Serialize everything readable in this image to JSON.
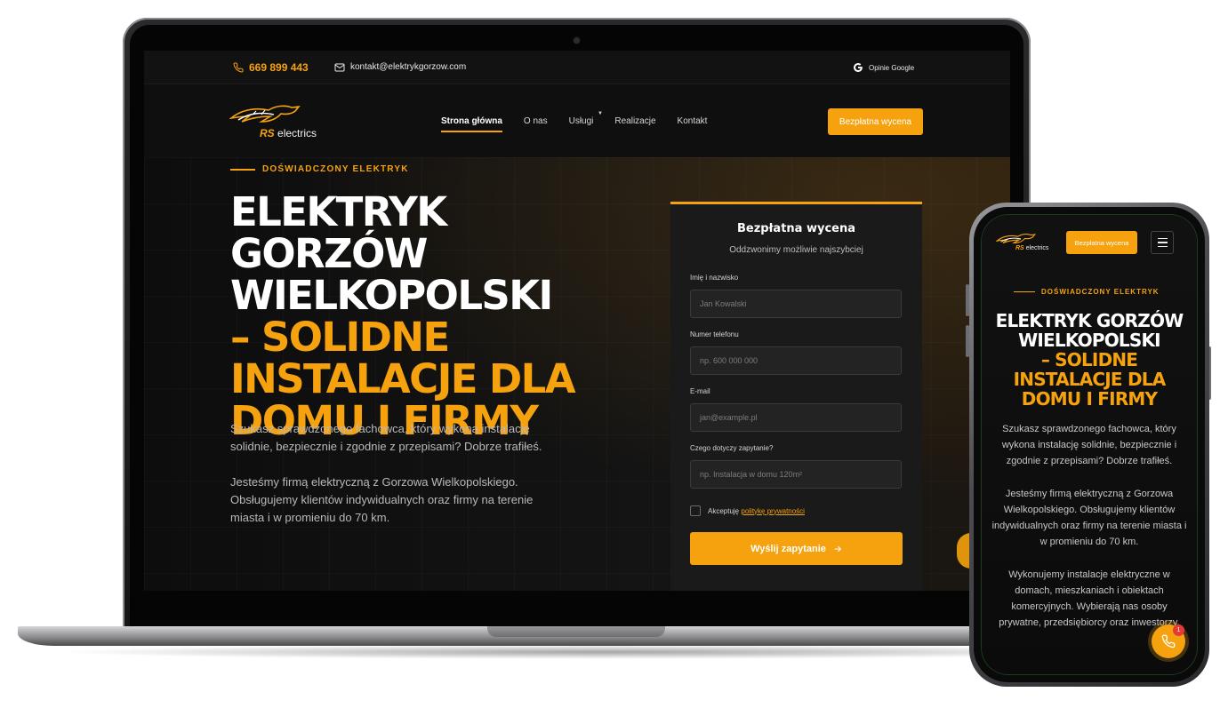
{
  "laptop": {
    "topbar": {
      "phone": "669 899 443",
      "email": "kontakt@elektrykgorzow.com",
      "google": "Opinie Google"
    },
    "logo": {
      "rs": "RS",
      "name": "electrics"
    },
    "nav": {
      "items": [
        "Strona główna",
        "O nas",
        "Usługi",
        "Realizacje",
        "Kontakt"
      ],
      "active": "Strona główna",
      "cta": "Bezpłatna wycena"
    },
    "hero": {
      "eyebrow": "DOŚWIADCZONY ELEKTRYK",
      "title_line1": "ELEKTRYK GORZÓW",
      "title_line2": "WIELKOPOLSKI",
      "title_accent1": "– SOLIDNE",
      "title_accent2": "INSTALACJE DLA",
      "title_accent3": "DOMU I FIRMY",
      "p1": "Szukasz sprawdzonego fachowca, który wykona instalację solidnie, bezpiecznie i zgodnie z przepisami? Dobrze trafiłeś.",
      "p2": "Jesteśmy firmą elektryczną z Gorzowa Wielkopolskiego. Obsługujemy klientów indywidualnych oraz firmy na terenie miasta i w promieniu do 70 km."
    },
    "form": {
      "title": "Bezpłatna wycena",
      "subtitle": "Oddzwonimy możliwie najszybciej",
      "name_label": "Imię i nazwisko",
      "name_placeholder": "Jan Kowalski",
      "phone_label": "Numer telefonu",
      "phone_placeholder": "np. 600 000 000",
      "email_label": "E-mail",
      "email_placeholder": "jan@example.pl",
      "topic_label": "Czego dotyczy zapytanie?",
      "topic_placeholder": "np. Instalacja w domu 120m²",
      "consent_prefix": "Akceptuję",
      "consent_link": "politykę prywatności",
      "submit": "Wyślij zapytanie"
    }
  },
  "phone": {
    "logo": {
      "rs": "RS",
      "name": "electrics"
    },
    "cta": "Bezpłatna wycena",
    "eyebrow": "DOŚWIADCZONY ELEKTRYK",
    "title_line1": "ELEKTRYK GORZÓW",
    "title_line2": "WIELKOPOLSKI",
    "title_accent1": "– SOLIDNE",
    "title_accent2": "INSTALACJE DLA",
    "title_accent3": "DOMU I FIRMY",
    "p1": "Szukasz sprawdzonego fachowca, który wykona instalację solidnie, bezpiecznie i zgodnie z przepisami? Dobrze trafiłeś.",
    "p2": "Jesteśmy firmą elektryczną z Gorzowa Wielkopolskiego. Obsługujemy klientów indywidualnych oraz firmy na terenie miasta i w promieniu do 70 km.",
    "p3": "Wykonujemy instalacje elektryczne w domach, mieszkaniach i obiektach komercyjnych. Wybierają nas osoby prywatne, przedsiębiorcy oraz inwestorzy.",
    "fab_badge": "1"
  },
  "colors": {
    "accent": "#f5a20e",
    "background": "#0c0c0c",
    "text": "#ffffff",
    "badge": "#e53935"
  },
  "icons": [
    "phone-icon",
    "mail-icon",
    "google-icon",
    "dropdown-caret-icon",
    "arrow-right-icon",
    "menu-icon",
    "panther-logo-icon"
  ]
}
